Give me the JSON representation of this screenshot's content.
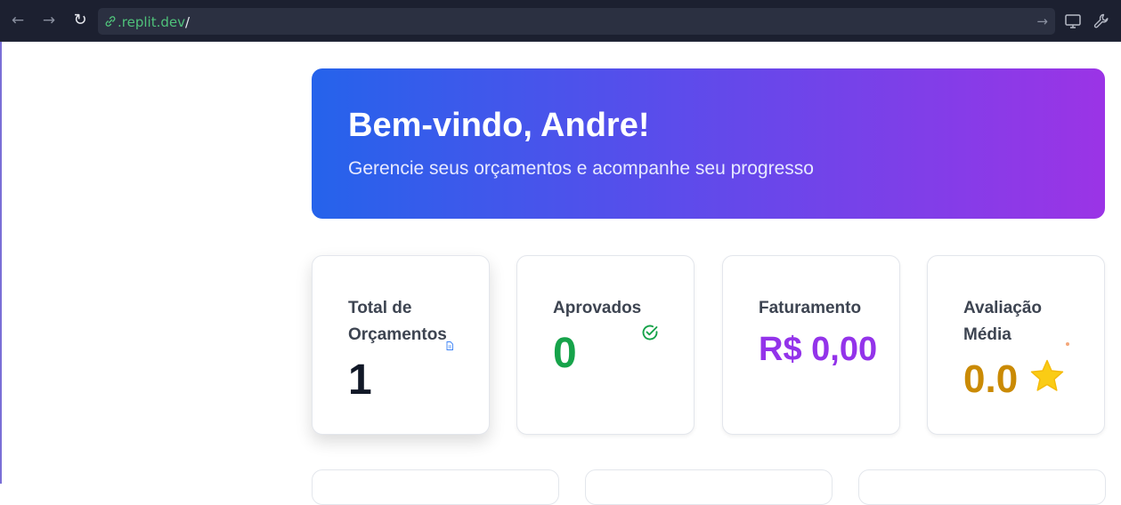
{
  "browser": {
    "url_domain": ".replit.dev",
    "url_path": "/",
    "back_icon": "←",
    "forward_icon": "→",
    "reload_icon": "↻",
    "go_icon": "→"
  },
  "hero": {
    "title": "Bem-vindo, Andre!",
    "subtitle": "Gerencie seus orçamentos e acompanhe seu progresso"
  },
  "stats": [
    {
      "label": "Total de Orçamentos",
      "value": "1",
      "icon": "document-icon",
      "color": "#111827"
    },
    {
      "label": "Aprovados",
      "value": "0",
      "icon": "check-circle-icon",
      "color": "#16a34a"
    },
    {
      "label": "Faturamento",
      "value": "R$ 0,00",
      "icon": "",
      "color": "#9333ea"
    },
    {
      "label": "Avaliação Média",
      "value": "0.0",
      "icon": "star-icon",
      "color": "#ca8a04"
    }
  ],
  "colors": {
    "hero_start": "#2563eb",
    "hero_end": "#9b34e6",
    "browser_bar": "#1c2030"
  }
}
